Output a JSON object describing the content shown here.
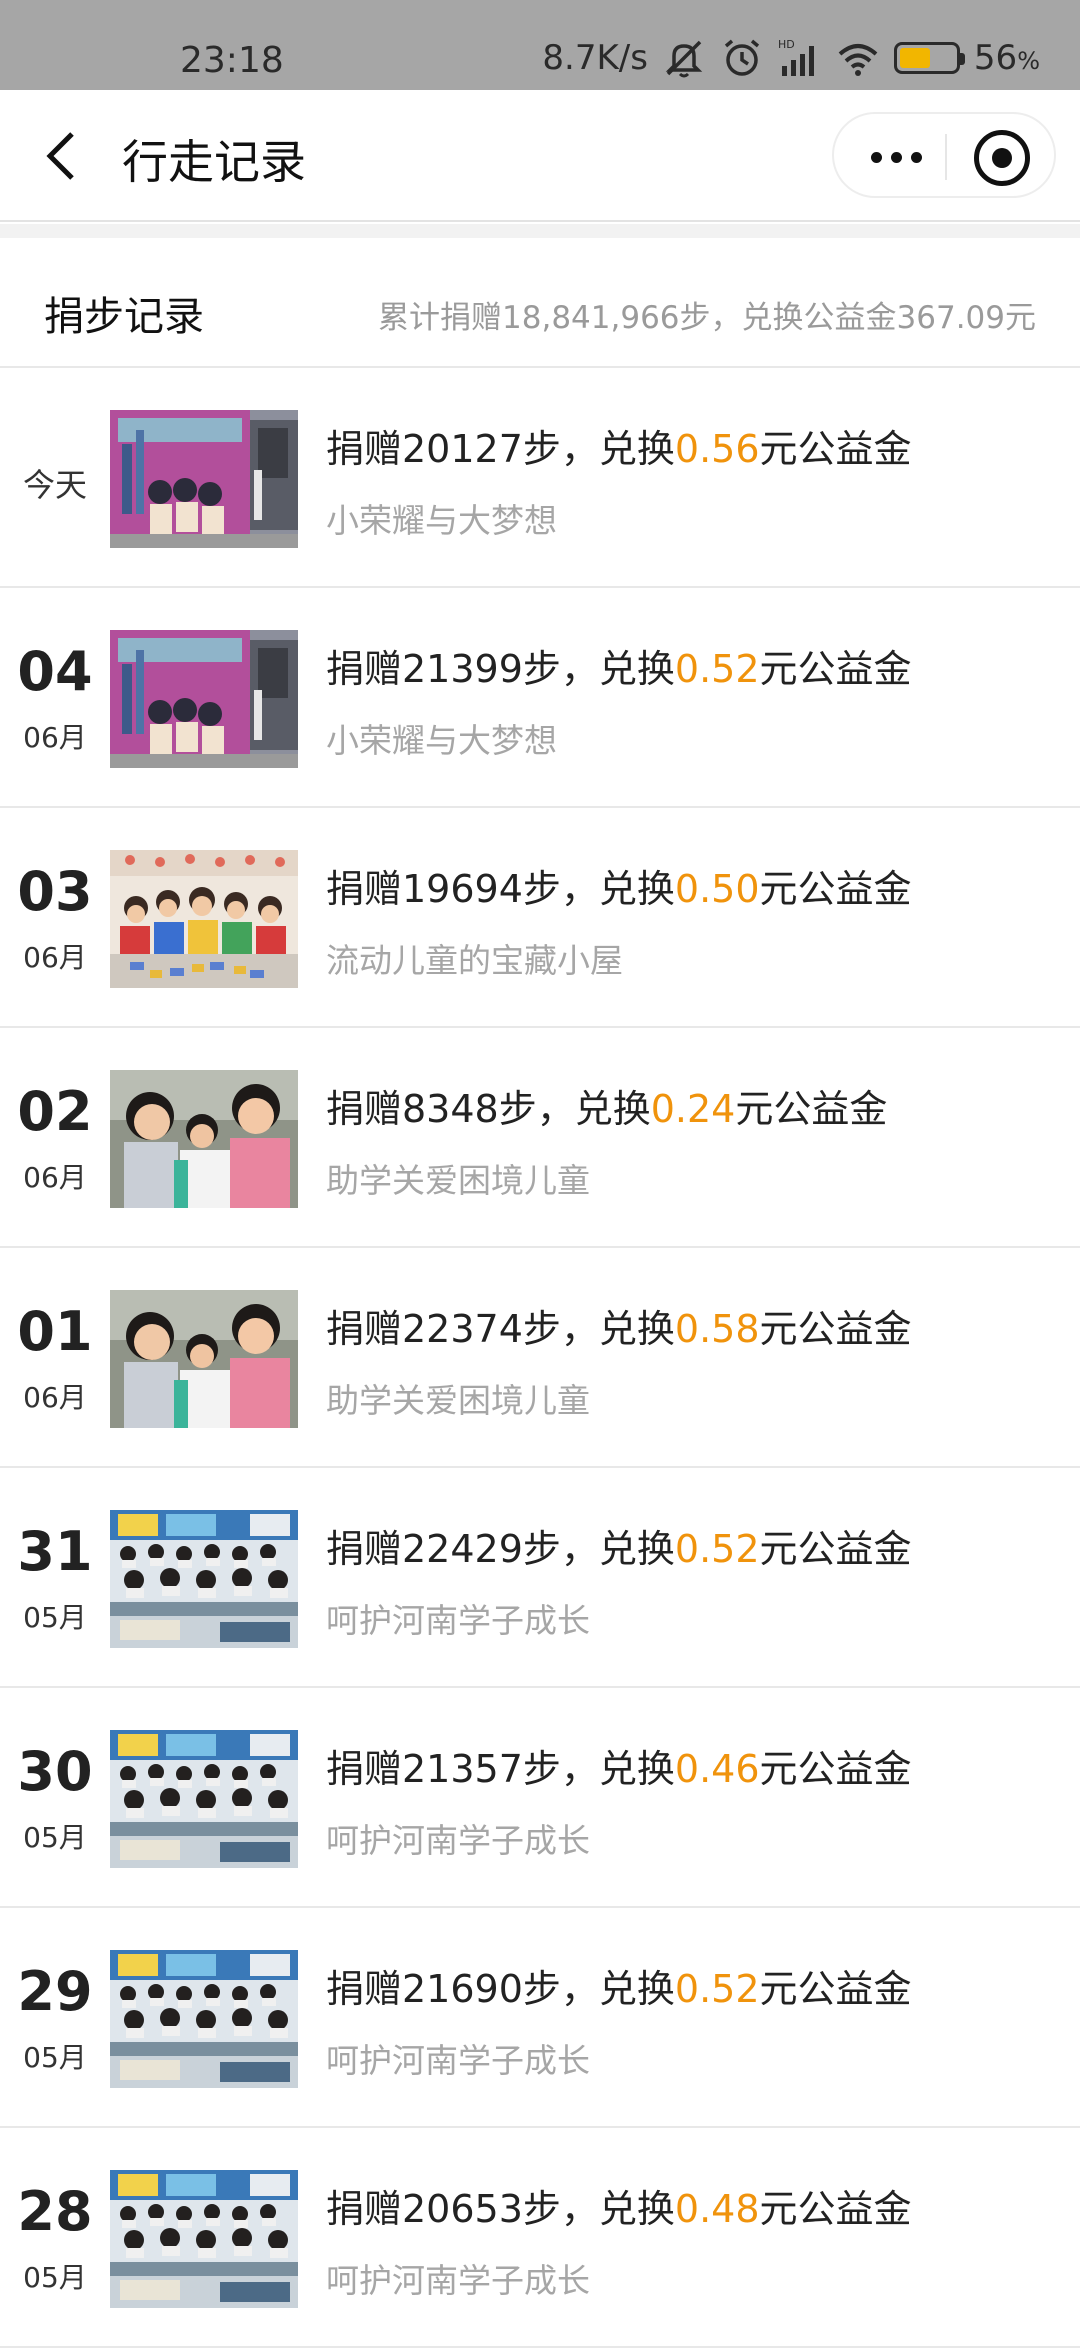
{
  "status_bar": {
    "time": "23:18",
    "net_speed": "8.7K/s",
    "battery_level": 56,
    "battery_percent": "56",
    "battery_unit": "%",
    "icons": [
      "mute-icon",
      "alarm-icon",
      "hd-signal-icon",
      "wifi-icon",
      "battery-icon"
    ]
  },
  "header": {
    "title": "行走记录"
  },
  "summary": {
    "title": "捐步记录",
    "total": "累计捐赠18,841,966步，兑换公益金367.09元"
  },
  "records": [
    {
      "label": "今天",
      "day": "",
      "month": "",
      "prefix": "捐赠20127步，兑换",
      "amount": "0.56",
      "suffix": "元公益金",
      "project": "小荣耀与大梦想",
      "thumb": "mural"
    },
    {
      "label": "",
      "day": "04",
      "month": "06月",
      "prefix": "捐赠21399步，兑换",
      "amount": "0.52",
      "suffix": "元公益金",
      "project": "小荣耀与大梦想",
      "thumb": "mural"
    },
    {
      "label": "",
      "day": "03",
      "month": "06月",
      "prefix": "捐赠19694步，兑换",
      "amount": "0.50",
      "suffix": "元公益金",
      "project": "流动儿童的宝藏小屋",
      "thumb": "classroom-kids"
    },
    {
      "label": "",
      "day": "02",
      "month": "06月",
      "prefix": "捐赠8348步，兑换",
      "amount": "0.24",
      "suffix": "元公益金",
      "project": "助学关爱困境儿童",
      "thumb": "girls"
    },
    {
      "label": "",
      "day": "01",
      "month": "06月",
      "prefix": "捐赠22374步，兑换",
      "amount": "0.58",
      "suffix": "元公益金",
      "project": "助学关爱困境儿童",
      "thumb": "girls"
    },
    {
      "label": "",
      "day": "31",
      "month": "05月",
      "prefix": "捐赠22429步，兑换",
      "amount": "0.52",
      "suffix": "元公益金",
      "project": "呵护河南学子成长",
      "thumb": "desks"
    },
    {
      "label": "",
      "day": "30",
      "month": "05月",
      "prefix": "捐赠21357步，兑换",
      "amount": "0.46",
      "suffix": "元公益金",
      "project": "呵护河南学子成长",
      "thumb": "desks"
    },
    {
      "label": "",
      "day": "29",
      "month": "05月",
      "prefix": "捐赠21690步，兑换",
      "amount": "0.52",
      "suffix": "元公益金",
      "project": "呵护河南学子成长",
      "thumb": "desks"
    },
    {
      "label": "",
      "day": "28",
      "month": "05月",
      "prefix": "捐赠20653步，兑换",
      "amount": "0.48",
      "suffix": "元公益金",
      "project": "呵护河南学子成长",
      "thumb": "desks"
    }
  ],
  "colors": {
    "status_bar_bg": "#a6a6a6",
    "amount": "#f0930c",
    "secondary_text": "#a6a6a6",
    "battery_fill": "#f2b600"
  }
}
